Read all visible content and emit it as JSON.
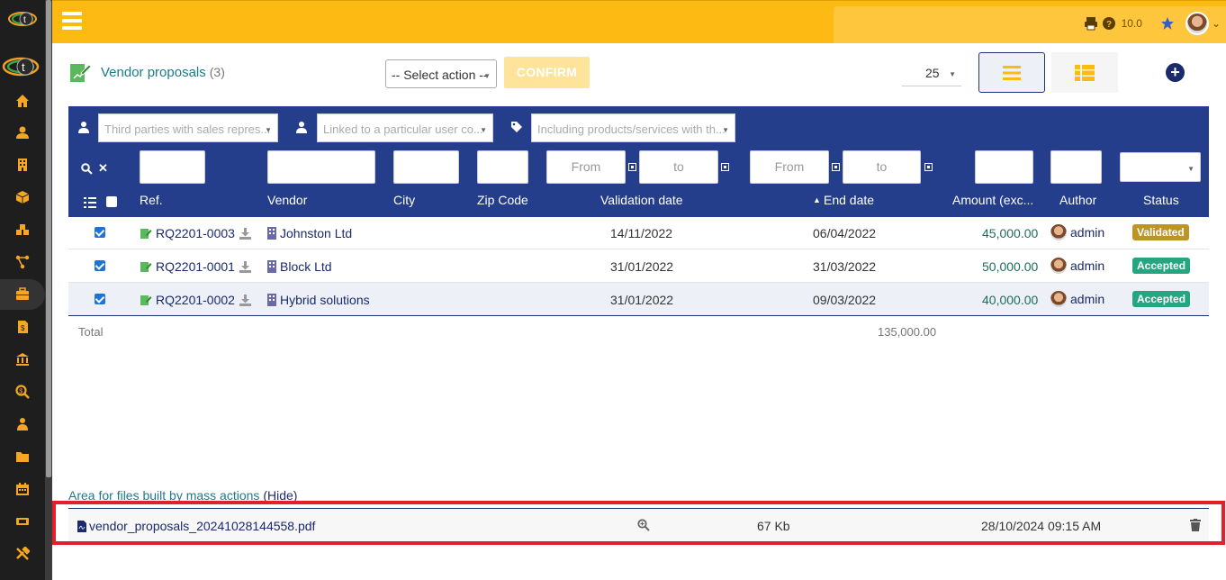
{
  "app": {
    "version": "10.0",
    "colors": {
      "topbar": "#fdba12",
      "header": "#243e8c",
      "link": "#1b2a6b",
      "accent": "#1e7a8a",
      "badge_validated": "#bc9526",
      "badge_accepted": "#25a580",
      "highlight_box": "#e2202a"
    }
  },
  "sidebar": {
    "items": [
      {
        "icon": "home-icon"
      },
      {
        "icon": "user-icon"
      },
      {
        "icon": "building-icon"
      },
      {
        "icon": "cube-icon"
      },
      {
        "icon": "cubes-icon"
      },
      {
        "icon": "project-icon"
      },
      {
        "icon": "briefcase-icon",
        "active": true
      },
      {
        "icon": "invoice-icon"
      },
      {
        "icon": "bank-icon"
      },
      {
        "icon": "search-dollar-icon"
      },
      {
        "icon": "users-icon"
      },
      {
        "icon": "folder-icon"
      },
      {
        "icon": "calendar-icon"
      },
      {
        "icon": "ticket-icon"
      },
      {
        "icon": "tools-icon"
      }
    ]
  },
  "page": {
    "title": "Vendor proposals",
    "count": "(3)"
  },
  "toolbar": {
    "select_action": "-- Select action --",
    "confirm_label": "CONFIRM",
    "page_size": "25"
  },
  "filters": {
    "sales_rep_placeholder": "Third parties with sales repres...",
    "user_contact_placeholder": "Linked to a particular user co...",
    "products_placeholder": "Including products/services with th...",
    "validation_from": "From",
    "validation_to": "to",
    "end_from": "From",
    "end_to": "to"
  },
  "columns": {
    "ref": "Ref.",
    "vendor": "Vendor",
    "city": "City",
    "zip": "Zip Code",
    "validation_date": "Validation date",
    "end_date": "End date",
    "amount": "Amount (exc...",
    "author": "Author",
    "status": "Status"
  },
  "rows": [
    {
      "ref": "RQ2201-0003",
      "vendor": "Johnston Ltd",
      "validation_date": "14/11/2022",
      "end_date": "06/04/2022",
      "amount": "45,000.00",
      "author": "admin",
      "status": "Validated"
    },
    {
      "ref": "RQ2201-0001",
      "vendor": "Block Ltd",
      "validation_date": "31/01/2022",
      "end_date": "31/03/2022",
      "amount": "50,000.00",
      "author": "admin",
      "status": "Accepted"
    },
    {
      "ref": "RQ2201-0002",
      "vendor": "Hybrid solutions",
      "validation_date": "31/01/2022",
      "end_date": "09/03/2022",
      "amount": "40,000.00",
      "author": "admin",
      "status": "Accepted"
    }
  ],
  "totals": {
    "label": "Total",
    "amount": "135,000.00"
  },
  "mass_files": {
    "title": "Area for files built by mass actions",
    "hide_label": "(Hide)",
    "file_name": "vendor_proposals_20241028144558.pdf",
    "file_size": "67 Kb",
    "file_date": "28/10/2024 09:15 AM"
  }
}
